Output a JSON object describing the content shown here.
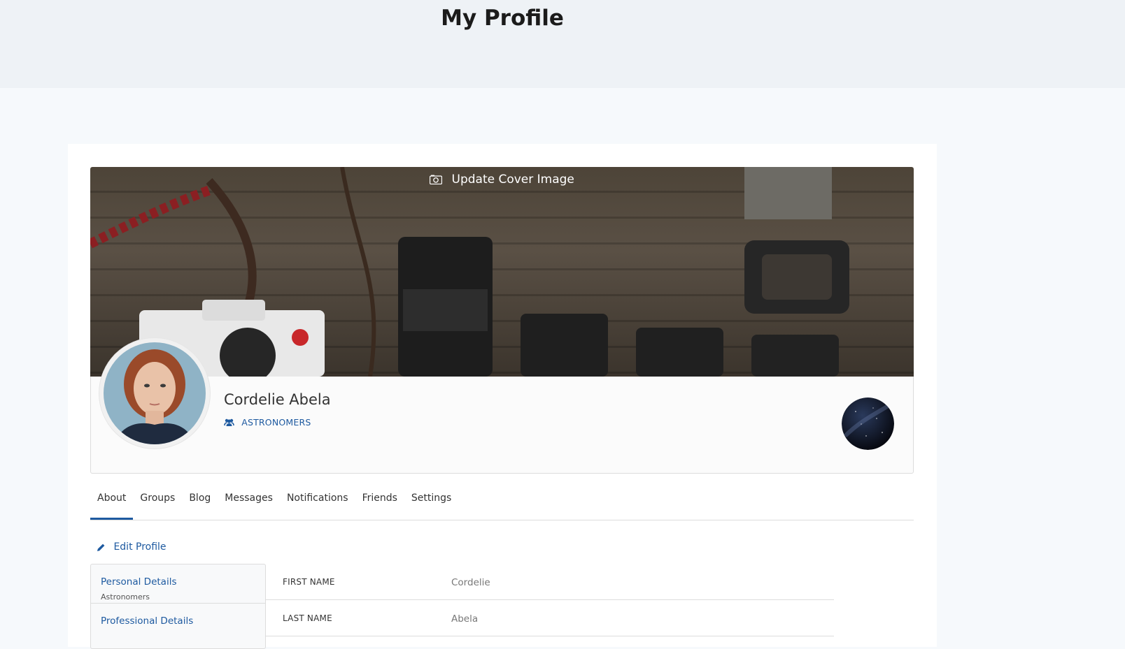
{
  "page": {
    "title": "My Profile"
  },
  "cover": {
    "update_label": "Update Cover Image"
  },
  "profile": {
    "name": "Cordelie Abela",
    "group": "ASTRONOMERS"
  },
  "tabs": [
    {
      "label": "About",
      "active": true
    },
    {
      "label": "Groups"
    },
    {
      "label": "Blog"
    },
    {
      "label": "Messages"
    },
    {
      "label": "Notifications"
    },
    {
      "label": "Friends"
    },
    {
      "label": "Settings"
    }
  ],
  "edit": {
    "label": "Edit Profile"
  },
  "sidebar": {
    "items": [
      {
        "title": "Personal Details",
        "subtitle": "Astronomers"
      },
      {
        "title": "Professional Details"
      }
    ]
  },
  "details": {
    "rows": [
      {
        "label": "FIRST NAME",
        "value": "Cordelie"
      },
      {
        "label": "LAST NAME",
        "value": "Abela"
      }
    ]
  },
  "colors": {
    "accent": "#1e5aa0",
    "band": "#eef2f6",
    "bg": "#f6f9fc"
  },
  "icons": {
    "cover": "camera-icon",
    "group": "users-icon",
    "edit": "pencil-icon"
  }
}
